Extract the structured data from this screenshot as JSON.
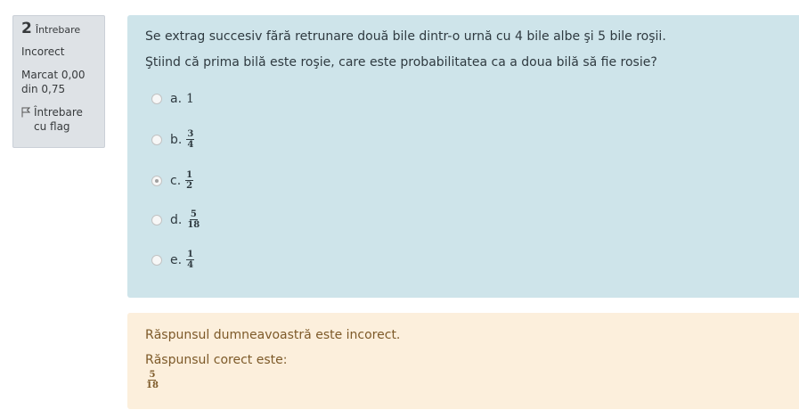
{
  "info": {
    "question_number": "2",
    "question_label": "Întrebare",
    "state": "Incorect",
    "grade": "Marcat 0,00 din 0,75",
    "flag_label": "Întrebare cu flag",
    "flag_icon": "flag-outline-icon"
  },
  "question": {
    "text_line1": "Se extrag succesiv fără retrunare două bile dintr-o urnă cu 4 bile albe şi 5 bile roşii.",
    "text_line2": "Ştiind că prima bilă este roşie, care este probabilitatea ca a doua bilă să fie rosie?",
    "options": [
      {
        "letter": "a.",
        "value": "1",
        "selected": false
      },
      {
        "letter": "b.",
        "numerator": "3",
        "denominator": "4",
        "selected": false
      },
      {
        "letter": "c.",
        "numerator": "1",
        "denominator": "2",
        "selected": true
      },
      {
        "letter": "d.",
        "numerator": "5",
        "denominator": "18",
        "selected": false
      },
      {
        "letter": "e.",
        "numerator": "1",
        "denominator": "4",
        "selected": false
      }
    ]
  },
  "feedback": {
    "incorrect_message": "Răspunsul dumneavoastră este incorect.",
    "correct_answer_label": "Răspunsul corect este:",
    "correct_numerator": "5",
    "correct_denominator": "18"
  },
  "colors": {
    "info_bg": "#dee2e6",
    "question_bg": "#cee4ea",
    "feedback_bg": "#fcefdc",
    "feedback_text": "#7d5a29"
  }
}
